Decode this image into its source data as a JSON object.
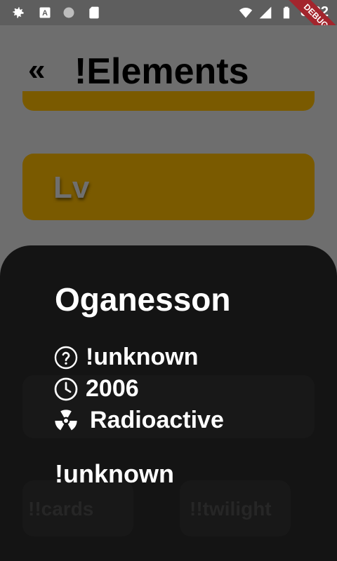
{
  "status_bar": {
    "time": "8:22",
    "debug_label": "DEBUG",
    "icons": [
      "gear-icon",
      "a-box-icon",
      "circle-icon",
      "sd-card-icon",
      "wifi-icon",
      "signal-icon",
      "battery-icon"
    ]
  },
  "header": {
    "back_label": "«",
    "title": "!Elements"
  },
  "cards": {
    "lv_symbol": "Lv"
  },
  "sheet": {
    "element_name": "Oganesson",
    "properties": [
      {
        "icon": "help-circle-icon",
        "text": "!unknown"
      },
      {
        "icon": "clock-icon",
        "text": "2006"
      },
      {
        "icon": "radioactive-icon",
        "text": "Radioactive"
      }
    ],
    "footer_text": "!unknown",
    "ghost_buttons": [
      "!!cards",
      "!!twilight"
    ]
  },
  "colors": {
    "accent": "#7a5a00",
    "sheet": "#141414",
    "overlay": "#6e6e6e"
  }
}
